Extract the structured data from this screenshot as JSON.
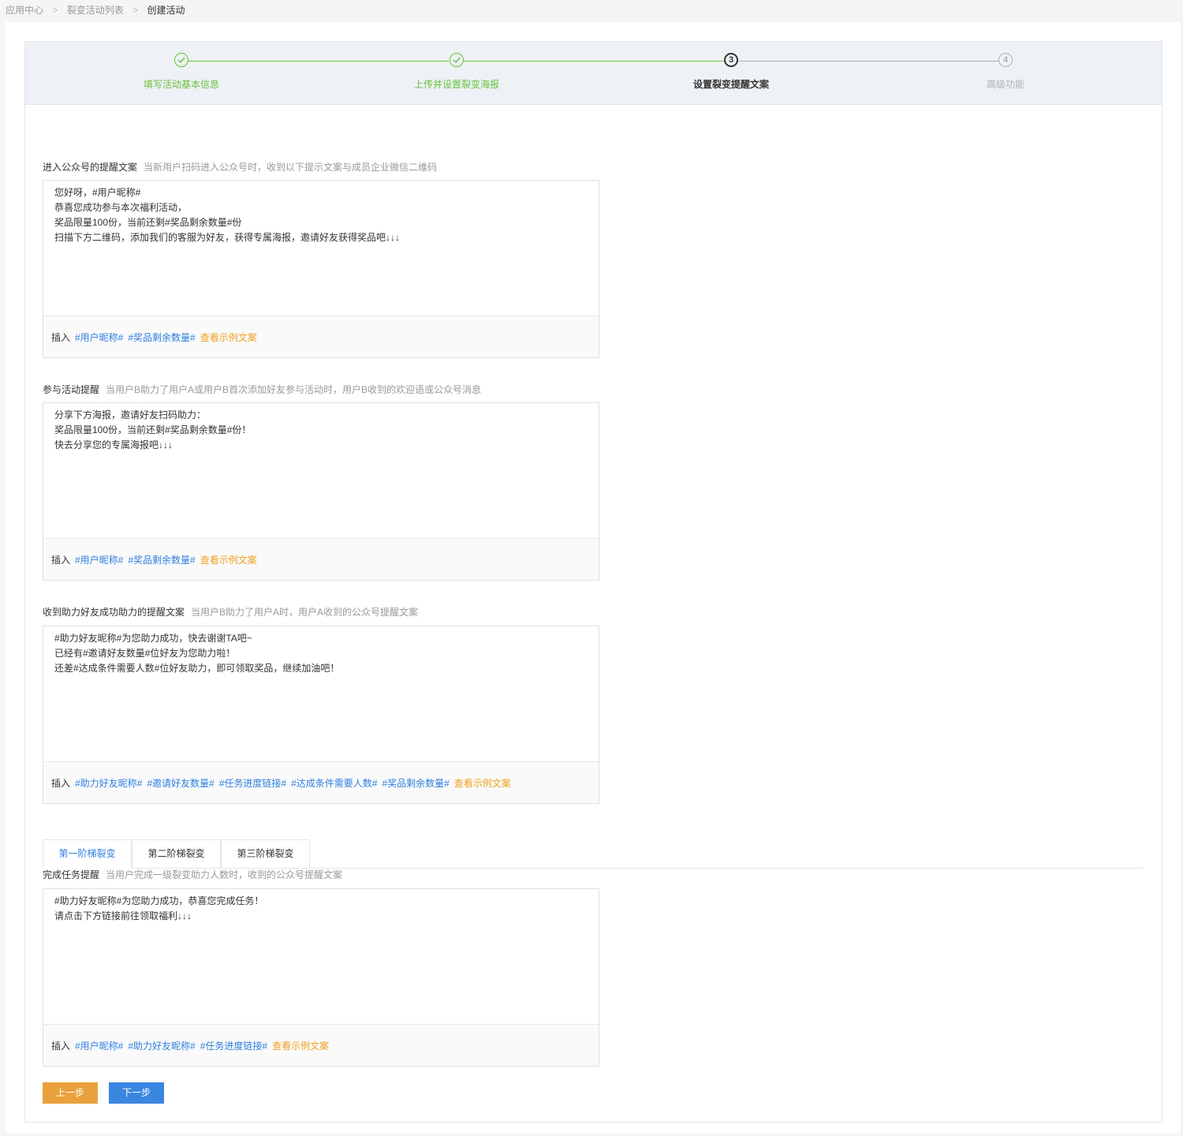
{
  "breadcrumb": {
    "items": [
      "应用中心",
      "裂变活动列表"
    ],
    "current": "创建活动",
    "separator": ">"
  },
  "steps": [
    {
      "label": "填写活动基本信息",
      "status": "done",
      "number": "1"
    },
    {
      "label": "上传并设置裂变海报",
      "status": "done",
      "number": "2"
    },
    {
      "label": "设置裂变提醒文案",
      "status": "active",
      "number": "3"
    },
    {
      "label": "高级功能",
      "status": "pending",
      "number": "4"
    }
  ],
  "sections": [
    {
      "title": "进入公众号的提醒文案",
      "hint": "当新用户扫码进入公众号时，收到以下提示文案与成员企业微信二维码",
      "content": "您好呀，#用户昵称#\n恭喜您成功参与本次福利活动，\n奖品限量100份，当前还剩#奖品剩余数量#份\n扫描下方二维码，添加我们的客服为好友，获得专属海报，邀请好友获得奖品吧↓↓↓",
      "insert_label": "插入",
      "tags": [
        "#用户昵称#",
        "#奖品剩余数量#"
      ],
      "sample_link": "查看示例文案"
    },
    {
      "title": "参与活动提醒",
      "hint": "当用户B助力了用户A或用户B首次添加好友参与活动时，用户B收到的欢迎语或公众号消息",
      "content": "分享下方海报，邀请好友扫码助力：\n奖品限量100份，当前还剩#奖品剩余数量#份！\n快去分享您的专属海报吧↓↓↓",
      "insert_label": "插入",
      "tags": [
        "#用户昵称#",
        "#奖品剩余数量#"
      ],
      "sample_link": "查看示例文案"
    },
    {
      "title": "收到助力好友成功助力的提醒文案",
      "hint": "当用户B助力了用户A时，用户A收到的公众号提醒文案",
      "content": "#助力好友昵称#为您助力成功，快去谢谢TA吧~\n已经有#邀请好友数量#位好友为您助力啦！\n还差#达成条件需要人数#位好友助力，即可领取奖品，继续加油吧！",
      "insert_label": "插入",
      "tags": [
        "#助力好友昵称#",
        "#邀请好友数量#",
        "#任务进度链接#",
        "#达成条件需要人数#",
        "#奖品剩余数量#"
      ],
      "sample_link": "查看示例文案"
    },
    {
      "title": "完成任务提醒",
      "hint": "当用户完成一级裂变助力人数时，收到的公众号提醒文案",
      "content": "#助力好友昵称#为您助力成功，恭喜您完成任务！\n请点击下方链接前往领取福利↓↓↓",
      "insert_label": "插入",
      "tags": [
        "#用户昵称#",
        "#助力好友昵称#",
        "#任务进度链接#"
      ],
      "sample_link": "查看示例文案"
    }
  ],
  "tabs": [
    {
      "label": "第一阶梯裂变",
      "active": true
    },
    {
      "label": "第二阶梯裂变",
      "active": false
    },
    {
      "label": "第三阶梯裂变",
      "active": false
    }
  ],
  "buttons": {
    "prev_label": "上一步",
    "next_label": "下一步"
  },
  "colors": {
    "done": "#67c23a",
    "link": "#2f7fe0",
    "sample": "#f0a020",
    "prev_button": "#e9a23b",
    "next_button": "#3a86e0"
  }
}
